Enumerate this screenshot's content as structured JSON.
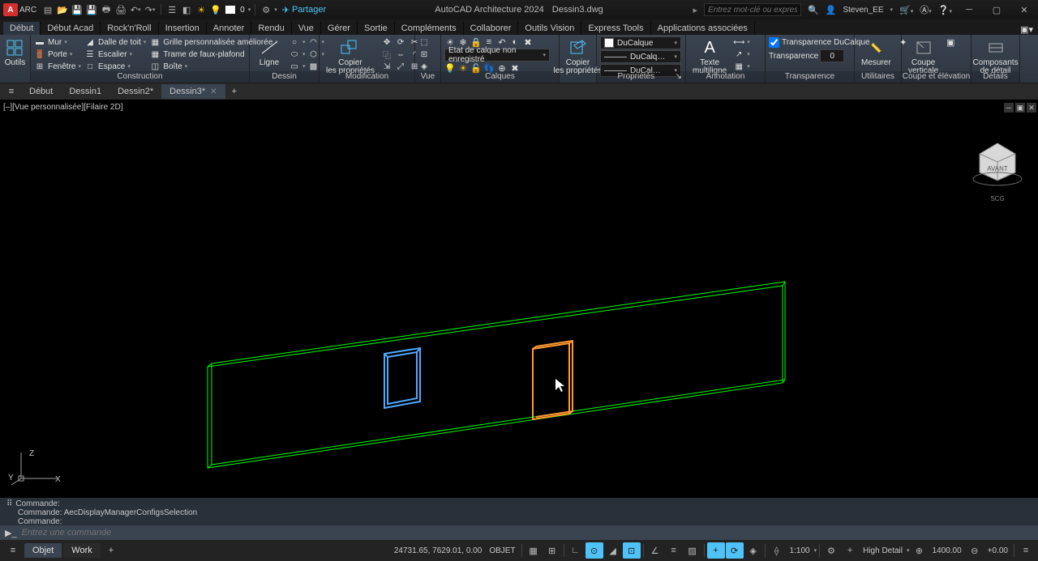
{
  "title": {
    "app": "AutoCAD Architecture 2024",
    "file": "Dessin3.dwg",
    "arc": "ARC"
  },
  "search": {
    "placeholder": "Entrez mot-clé ou expression"
  },
  "user": {
    "name": "Steven_EE"
  },
  "share": {
    "label": "Partager"
  },
  "qat_zero": "0",
  "tabs": [
    "Début",
    "Début Acad",
    "Rock'n'Roll",
    "Insertion",
    "Annoter",
    "Rendu",
    "Vue",
    "Gérer",
    "Sortie",
    "Compléments",
    "Collaborer",
    "Outils Vision",
    "Express Tools",
    "Applications associées"
  ],
  "active_tab": 0,
  "ribbon": {
    "outils": "Outils",
    "construction": {
      "title": "Construction",
      "mur": "Mur",
      "porte": "Porte",
      "fenetre": "Fenêtre",
      "dalle": "Dalle de toit",
      "escalier": "Escalier",
      "espace": "Espace",
      "grille": "Grille personnalisée améliorée",
      "trame": "Trame de faux-plafond",
      "boite": "Boîte"
    },
    "dessin": {
      "title": "Dessin",
      "ligne": "Ligne"
    },
    "modification": {
      "title": "Modification",
      "copier": "Copier\nles propriétés"
    },
    "vue": {
      "title": "Vue"
    },
    "calques": {
      "title": "Calques",
      "copier": "Copier\nles propriétés",
      "etat": "Etat de calque non enregistré"
    },
    "proprietes": {
      "title": "Propriétés",
      "color": "DuCalque",
      "line1": "DuCalq…",
      "line2": "DuCal…"
    },
    "annotation": {
      "title": "Annotation",
      "texte": "Texte\nmultiligne"
    },
    "transparence": {
      "title": "Transparence",
      "label": "Transparence DuCalque",
      "field": "Transparence",
      "val": "0"
    },
    "utilitaires": {
      "title": "Utilitaires",
      "mesurer": "Mesurer"
    },
    "coupe": {
      "title": "Coupe et élévation",
      "btn": "Coupe\nverticale"
    },
    "details": {
      "title": "Détails",
      "btn": "Composants\nde détail"
    }
  },
  "doctabs": {
    "items": [
      "Début",
      "Dessin1",
      "Dessin2*",
      "Dessin3*"
    ],
    "active": 3
  },
  "viewport": {
    "label": "[–][Vue personnalisée][Filaire 2D]",
    "ucs_x": "X",
    "ucs_y": "Y",
    "ucs_z": "Z",
    "cube_face": "AVANT",
    "cube_scg": "SCG"
  },
  "command": {
    "hist1": "Commande:",
    "hist2": "Commande: AecDisplayManagerConfigsSelection",
    "hist3": "Commande:",
    "placeholder": "Entrez une commande"
  },
  "status": {
    "tabs": [
      "Objet",
      "Work"
    ],
    "coords": "24731.65, 7629.01, 0.00",
    "mode": "OBJET",
    "scale": "1:100",
    "detail": "High Detail",
    "elev": "1400.00",
    "cut": "+0.00"
  }
}
